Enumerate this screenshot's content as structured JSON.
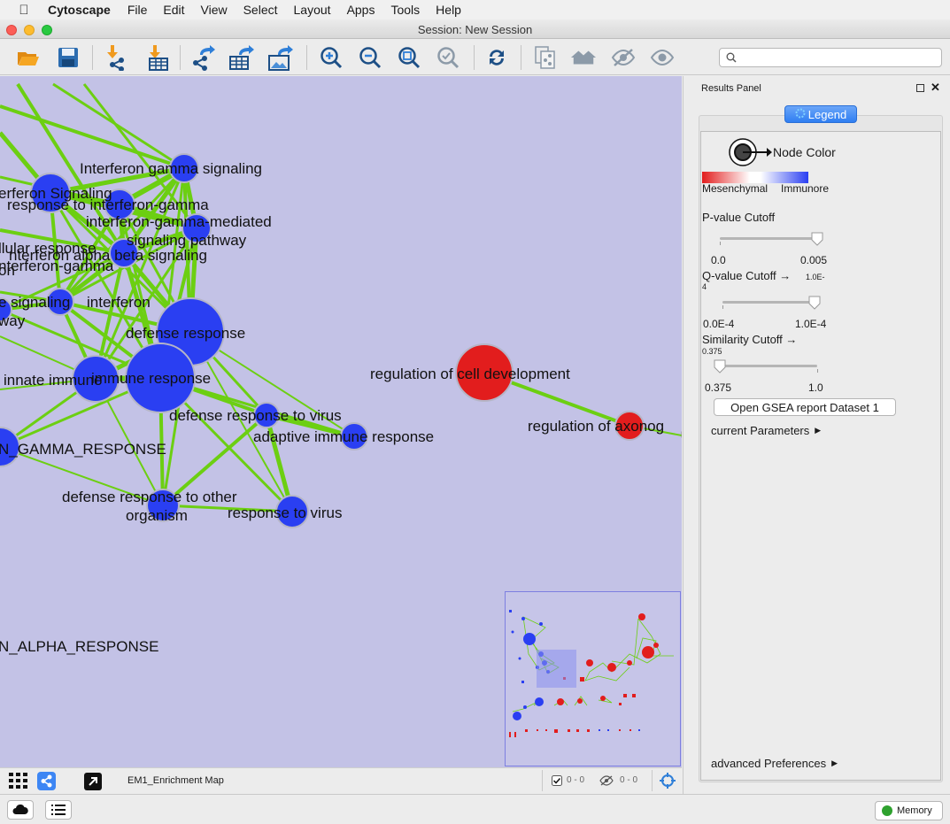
{
  "menubar": {
    "app_name": "Cytoscape",
    "items": [
      "File",
      "Edit",
      "View",
      "Select",
      "Layout",
      "Apps",
      "Tools",
      "Help"
    ]
  },
  "window": {
    "title": "Session: New Session"
  },
  "toolbar": {
    "search_placeholder": "",
    "icons": [
      "open-session",
      "save-session",
      "import-network",
      "import-table",
      "export-network",
      "export-table",
      "export-image",
      "zoom-in",
      "zoom-out",
      "zoom-fit",
      "zoom-selected",
      "apply-layout",
      "new-network-from-selection",
      "show-all",
      "hide",
      "show"
    ]
  },
  "network": {
    "labels": [
      "Interferon gamma signaling",
      "erferon Signaling",
      "response to interferon-gamma",
      "interferon-gamma-mediated",
      "signaling pathway",
      "llular response",
      "nterferon alpha beta signaling",
      "nterferon-gamma",
      "on",
      "e signaling",
      "interferon",
      "way",
      "defense response",
      "innate immune",
      "immune response",
      "defense response to virus",
      "adaptive immune response",
      "N_GAMMA_RESPONSE",
      "defense response to other",
      "organism",
      "response to virus",
      "regulation of cell development",
      "regulation of axonog",
      "N_ALPHA_RESPONSE"
    ]
  },
  "results_panel": {
    "title": "Results Panel",
    "legend_tab": "Legend",
    "node_color_label": "Node Color",
    "gradient_low": "Mesenchymal",
    "gradient_high": "Immunore",
    "pvalue": {
      "label": "P-value Cutoff",
      "min": "0.0",
      "max": "0.005",
      "level": 1.0
    },
    "qvalue": {
      "label": "Q-value Cutoff →",
      "current": "1.0E-",
      "current2": "4",
      "min": "0.0E-4",
      "max": "1.0E-4",
      "level": 1.0
    },
    "similarity": {
      "label": "Similarity Cutoff →",
      "current": "0.375",
      "min": "0.375",
      "max": "1.0",
      "level": 0.0
    },
    "open_report_button": "Open GSEA report Dataset 1",
    "current_parameters": "current Parameters",
    "advanced_preferences": "advanced Preferences"
  },
  "canvas_bar": {
    "network_name": "EM1_Enrichment Map",
    "selected_count": "0 - 0",
    "hidden_count": "0 - 0"
  },
  "statusbar": {
    "memory_label": "Memory"
  },
  "colors": {
    "canvas_bg": "#c3c2e6",
    "node_blue": "#2a3ff2",
    "node_red": "#e21d1d",
    "edge_green": "#6ccf12",
    "legend_tab": "#3d86f4"
  }
}
